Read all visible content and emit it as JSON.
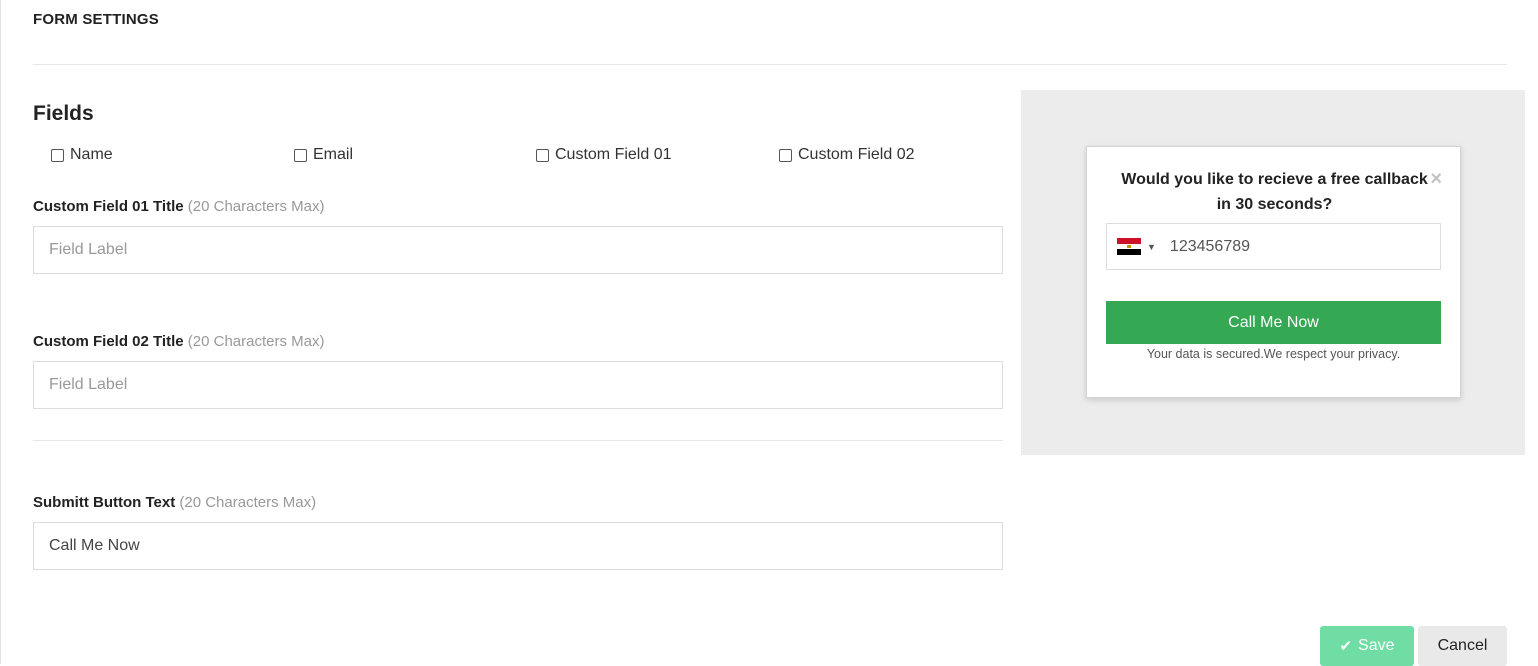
{
  "page": {
    "title": "FORM SETTINGS"
  },
  "fields": {
    "heading": "Fields",
    "options": [
      {
        "label": "Name",
        "checked": false
      },
      {
        "label": "Email",
        "checked": false
      },
      {
        "label": "Custom Field 01",
        "checked": false
      },
      {
        "label": "Custom Field 02",
        "checked": false
      }
    ]
  },
  "custom_field_1": {
    "label": "Custom Field 01 Title",
    "hint": "(20 Characters Max)",
    "placeholder": "Field Label",
    "value": ""
  },
  "custom_field_2": {
    "label": "Custom Field 02 Title",
    "hint": "(20 Characters Max)",
    "placeholder": "Field Label",
    "value": ""
  },
  "submit_text": {
    "label": "Submitt Button Text",
    "hint": "(20 Characters Max)",
    "value": "Call Me Now"
  },
  "preview": {
    "title": "Would you like to recieve a free callback in 30 seconds?",
    "close_icon": "×",
    "country_flag": "egypt-flag-icon",
    "phone_value": "123456789",
    "button_label": "Call Me Now",
    "button_color": "#34a853",
    "privacy_text": "Your data is secured.We respect your privacy."
  },
  "actions": {
    "save_label": "Save",
    "save_color": "#6fdda4",
    "cancel_label": "Cancel"
  }
}
